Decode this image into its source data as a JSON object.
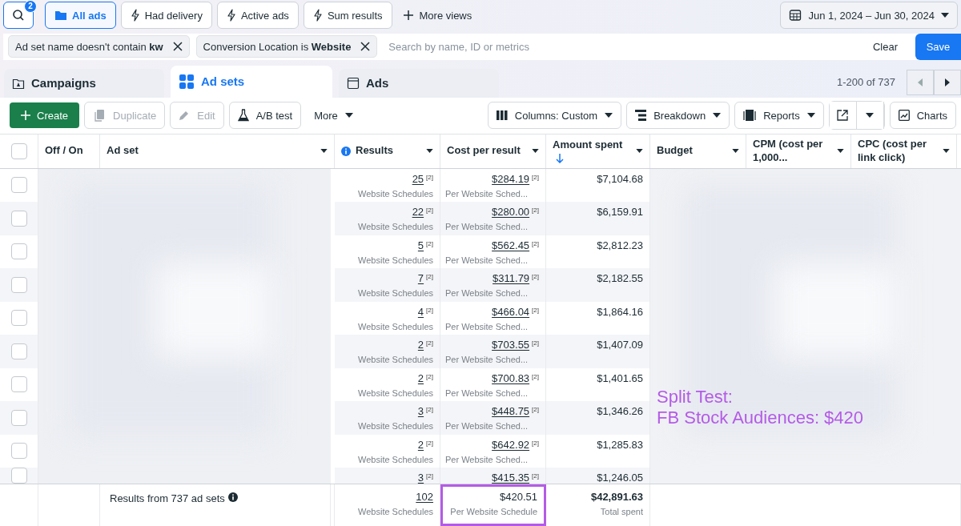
{
  "top_bar": {
    "search_badge": "2",
    "views": [
      {
        "label": "All ads",
        "selected": true
      },
      {
        "label": "Had delivery",
        "selected": false
      },
      {
        "label": "Active ads",
        "selected": false
      },
      {
        "label": "Sum results",
        "selected": false
      }
    ],
    "more_views": "More views",
    "date_range": "Jun 1, 2024 – Jun 30, 2024"
  },
  "filters": {
    "chips": [
      "Ad set name doesn't contain **kw**",
      "Conversion Location is **Website**"
    ],
    "search": {
      "placeholder": "Search by name, ID or metrics"
    },
    "clear": "Clear",
    "save": "Save"
  },
  "level_tabs": [
    {
      "label": "Campaigns",
      "selected": false
    },
    {
      "label": "Ad sets",
      "selected": true
    },
    {
      "label": "Ads",
      "selected": false
    }
  ],
  "pagination": "1-200 of 737",
  "toolbar": {
    "create": "Create",
    "duplicate": {
      "label": "Duplicate",
      "disabled": true
    },
    "edit": {
      "label": "Edit",
      "disabled": true
    },
    "ab_test": "A/B test",
    "more": "More",
    "columns": "Columns: Custom",
    "breakdown": "Breakdown",
    "reports": "Reports",
    "charts": "Charts"
  },
  "table": {
    "select_all": {
      "checked": false
    },
    "columns": [
      {
        "label": "Off / On",
        "sorted": false
      },
      {
        "label": "Ad set",
        "sorted": false
      },
      {
        "label": "Results",
        "sorted": false
      },
      {
        "label": "Cost per result",
        "sorted": false
      },
      {
        "label": "Amount spent",
        "sorted": true
      },
      {
        "label": "Budget",
        "sorted": false
      },
      {
        "label": "CPM (cost per 1,000...",
        "sorted": false
      },
      {
        "label": "CPC (cost per link click)",
        "sorted": false
      }
    ],
    "rows": [
      {
        "checked": false,
        "results": "25",
        "results_note": "[2]",
        "results_label": "Website Schedules",
        "cost": "$284.19",
        "cost_note": "[2]",
        "cost_label": "Per Website Sched...",
        "spent": "$7,104.68"
      },
      {
        "checked": false,
        "results": "22",
        "results_note": "[2]",
        "results_label": "Website Schedules",
        "cost": "$280.00",
        "cost_note": "[2]",
        "cost_label": "Per Website Sched...",
        "spent": "$6,159.91"
      },
      {
        "checked": false,
        "results": "5",
        "results_note": "[2]",
        "results_label": "Website Schedules",
        "cost": "$562.45",
        "cost_note": "[2]",
        "cost_label": "Per Website Sched...",
        "spent": "$2,812.23"
      },
      {
        "checked": false,
        "results": "7",
        "results_note": "[2]",
        "results_label": "Website Schedules",
        "cost": "$311.79",
        "cost_note": "[2]",
        "cost_label": "Per Website Sched...",
        "spent": "$2,182.55"
      },
      {
        "checked": false,
        "results": "4",
        "results_note": "[2]",
        "results_label": "Website Schedules",
        "cost": "$466.04",
        "cost_note": "[2]",
        "cost_label": "Per Website Sched...",
        "spent": "$1,864.16"
      },
      {
        "checked": false,
        "results": "2",
        "results_note": "[2]",
        "results_label": "Website Schedules",
        "cost": "$703.55",
        "cost_note": "[2]",
        "cost_label": "Per Website Sched...",
        "spent": "$1,407.09"
      },
      {
        "checked": false,
        "results": "2",
        "results_note": "[2]",
        "results_label": "Website Schedules",
        "cost": "$700.83",
        "cost_note": "[2]",
        "cost_label": "Per Website Sched...",
        "spent": "$1,401.65"
      },
      {
        "checked": false,
        "results": "3",
        "results_note": "[2]",
        "results_label": "Website Schedules",
        "cost": "$448.75",
        "cost_note": "[2]",
        "cost_label": "Per Website Sched...",
        "spent": "$1,346.26"
      },
      {
        "checked": false,
        "results": "2",
        "results_note": "[2]",
        "results_label": "Website Schedules",
        "cost": "$642.92",
        "cost_note": "[2]",
        "cost_label": "Per Website Sched...",
        "spent": "$1,285.83"
      },
      {
        "checked": false,
        "results": "3",
        "results_note": "[2]",
        "cost": "$415.35",
        "cost_note": "[2]",
        "spent": "$1,246.05"
      }
    ],
    "summary": {
      "label": "Results from 737 ad sets",
      "results": "102",
      "results_label": "Website Schedules",
      "cost": "$420.51",
      "cost_label": "Per Website Schedule",
      "cost_highlighted": true,
      "spent": "$42,891.63",
      "spent_label": "Total spent"
    }
  },
  "annotation": [
    "Split Test:",
    "FB Stock Audiences: $420"
  ]
}
